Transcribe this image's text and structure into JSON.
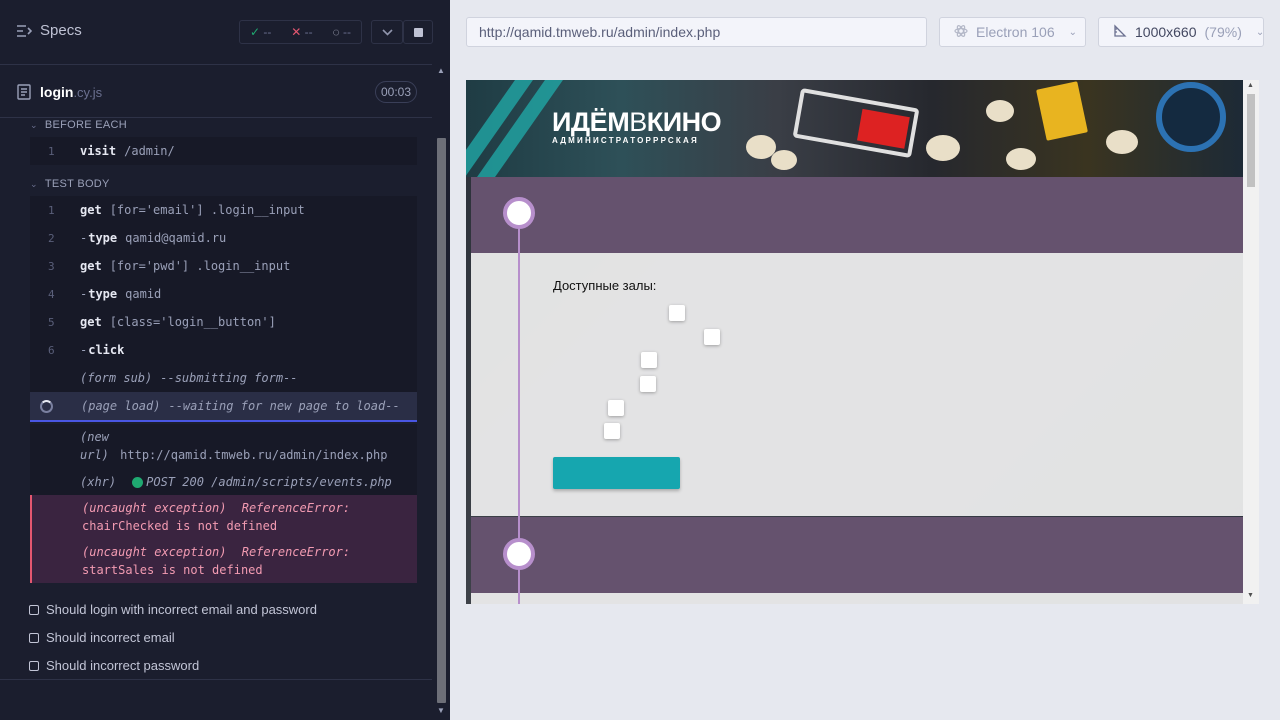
{
  "runner": {
    "specs_label": "Specs",
    "stats": {
      "passed": "--",
      "failed": "--",
      "pending": "--"
    },
    "spec": {
      "name": "login",
      "ext": ".cy.js",
      "duration": "00:03"
    },
    "before_each": {
      "label": "BEFORE EACH",
      "commands": [
        {
          "num": "1",
          "name": "visit",
          "message": "/admin/"
        }
      ]
    },
    "test_body": {
      "label": "TEST BODY",
      "commands": [
        {
          "num": "1",
          "name": "get",
          "message": "[for='email'] .login__input"
        },
        {
          "num": "2",
          "name": "type",
          "message": "qamid@qamid.ru"
        },
        {
          "num": "3",
          "name": "get",
          "message": "[for='pwd'] .login__input"
        },
        {
          "num": "4",
          "name": "type",
          "message": "qamid"
        },
        {
          "num": "5",
          "name": "get",
          "message": "[class='login__button']"
        },
        {
          "num": "6",
          "name": "click",
          "message": ""
        }
      ],
      "events": {
        "form_sub": {
          "tag": "(form sub)",
          "message": "--submitting form--"
        },
        "page_load": {
          "tag": "(page load)",
          "message": "--waiting for new page to load--"
        },
        "new_url": {
          "tag_line1": "(new",
          "tag_line2": "url)",
          "message": "http://qamid.tmweb.ru/admin/index.php"
        },
        "xhr": {
          "tag": "(xhr)",
          "message": "POST 200 /admin/scripts/events.php",
          "status_color": "#1fa971"
        }
      },
      "errors": [
        {
          "tag": "(uncaught exception)",
          "type": "ReferenceError:",
          "message": "chairChecked is not defined"
        },
        {
          "tag": "(uncaught exception)",
          "type": "ReferenceError:",
          "message": "startSales is not defined"
        }
      ]
    },
    "tests": [
      "Should login with incorrect email and password",
      "Should incorrect email",
      "Should incorrect password"
    ]
  },
  "browser": {
    "url": "http://qamid.tmweb.ru/admin/index.php",
    "browser_name": "Electron 106",
    "viewport": "1000x660",
    "zoom": "(79%)"
  },
  "app": {
    "logo_main_a": "ИДЁМ",
    "logo_main_b": "В",
    "logo_main_c": "КИНО",
    "logo_sub": "АДМИНИСТРАТОРРРСКАЯ",
    "halls_label": "Доступные залы:",
    "colors": {
      "accent": "#16a6af",
      "header_band": "#65526e",
      "timeline": "#b78fcc"
    }
  }
}
